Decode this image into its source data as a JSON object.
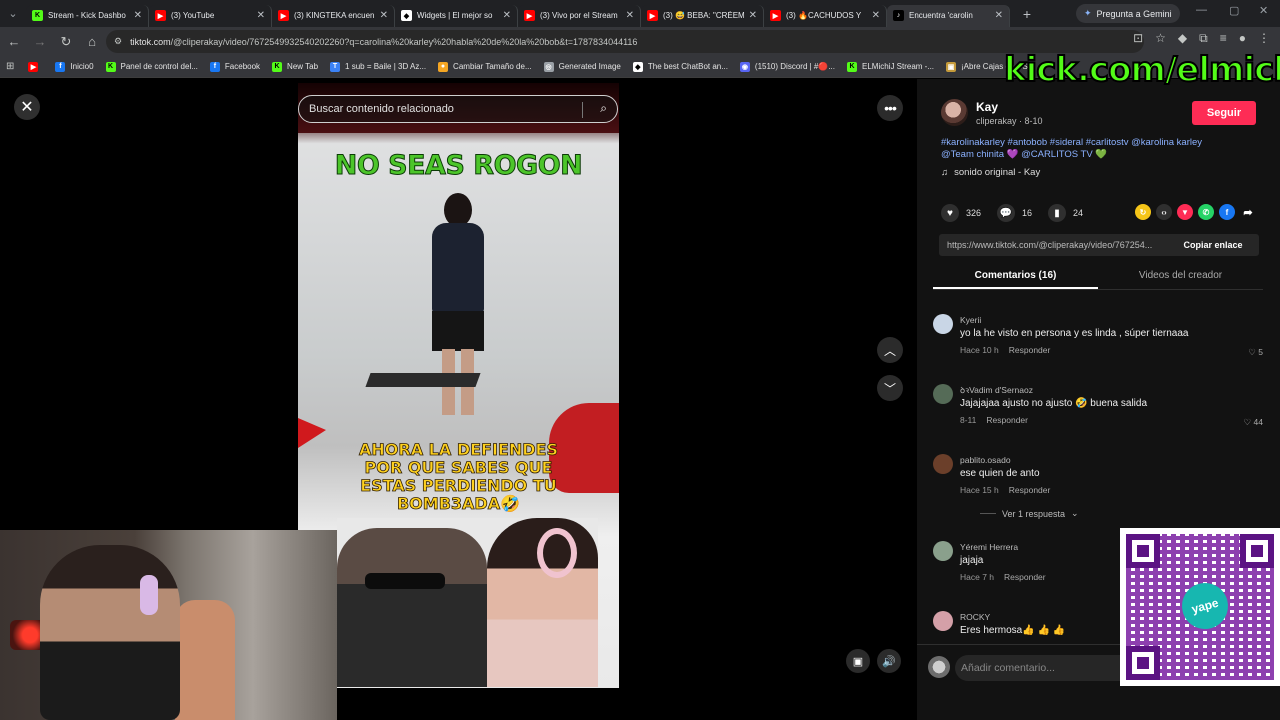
{
  "browser": {
    "tabs": [
      {
        "title": "Stream - Kick Dashbo",
        "fav": "K",
        "fav_color": "#53fc18"
      },
      {
        "title": "(3) YouTube",
        "fav": "▶",
        "fav_color": "#ff0000"
      },
      {
        "title": "(3) KINGTEKA encuen",
        "fav": "▶",
        "fav_color": "#ff0000"
      },
      {
        "title": "Widgets | El mejor so",
        "fav": "◆",
        "fav_color": "#ffffff"
      },
      {
        "title": "(3) Vivo por el Stream",
        "fav": "▶",
        "fav_color": "#ff0000"
      },
      {
        "title": "(3) 😅 BEBA: \"CRÉEM",
        "fav": "▶",
        "fav_color": "#ff0000"
      },
      {
        "title": "(3) 🔥CACHUDOS Y",
        "fav": "▶",
        "fav_color": "#ff0000"
      },
      {
        "title": "Encuentra 'carolin",
        "fav": "♪",
        "fav_color": "#000000"
      }
    ],
    "gemini_label": "Pregunta a Gemini",
    "url_host": "tiktok.com",
    "url_path": "/@cliperakay/video/7672549932540202260?q=carolina%20karley%20habla%20de%20la%20bob&t=1787834044116",
    "bookmarks": [
      {
        "label": "",
        "color": "#ff0000",
        "glyph": "▶"
      },
      {
        "label": "Inicio0",
        "color": "#1877f2",
        "glyph": "f"
      },
      {
        "label": "Panel de control del...",
        "color": "#53fc18",
        "glyph": "K"
      },
      {
        "label": "Facebook",
        "color": "#1877f2",
        "glyph": "f"
      },
      {
        "label": "New Tab",
        "color": "#53fc18",
        "glyph": "K"
      },
      {
        "label": "1 sub = Baile | 3D Az...",
        "color": "#3b82f6",
        "glyph": "T"
      },
      {
        "label": "Cambiar Tamaño de...",
        "color": "#f5a623",
        "glyph": "●"
      },
      {
        "label": "Generated Image",
        "color": "#9aa0a6",
        "glyph": "◎"
      },
      {
        "label": "The best ChatBot an...",
        "color": "#ffffff",
        "glyph": "◆"
      },
      {
        "label": "(1510) Discord | #🔴...",
        "color": "#5865f2",
        "glyph": "◉"
      },
      {
        "label": "ELMichiJ Stream -...",
        "color": "#53fc18",
        "glyph": "K"
      },
      {
        "label": "¡Abre Cajas de CS2",
        "color": "#c49a3a",
        "glyph": "▣"
      }
    ]
  },
  "video": {
    "search_placeholder": "Buscar contenido relacionado",
    "caption_top": "NO SEAS ROGON",
    "caption_bottom_lines": [
      "AHORA LA DEFIENDES",
      "POR QUE SABES QUE",
      "ESTAS PERDIENDO TU",
      "BOMB3ADA🤣"
    ]
  },
  "author": {
    "name": "Kay",
    "handle_date": "cliperakay · 8-10",
    "follow_label": "Seguir"
  },
  "description": {
    "line1": "#karolinakarley #antobob #sideral #carlitostv @karolina karley",
    "line2a": "@Team chinita",
    "line2b": "💜",
    "line2c": "@CARLITOS TV",
    "line2d": "💚",
    "music": "sonido original - Kay"
  },
  "stats": {
    "likes": "326",
    "comments": "16",
    "saves": "24"
  },
  "link": {
    "url": "https://www.tiktok.com/@cliperakay/video/767254...",
    "copy_label": "Copiar enlace"
  },
  "tabs": {
    "comments": "Comentarios (16)",
    "creator_videos": "Videos del creador"
  },
  "comments": [
    {
      "user": "Kyerii",
      "text": "yo la he visto en persona y es linda , súper tiernaaa",
      "time": "Hace 10 h",
      "reply": "Responder",
      "likes": "5",
      "avatar_color": "#c9d6e6"
    },
    {
      "user": "ꝺꝛVadim d'Sernaoz",
      "text": "Jajajajaa ajusto no ajusto 🤣 buena salida",
      "time": "8-11",
      "reply": "Responder",
      "likes": "44",
      "avatar_color": "#556b57"
    },
    {
      "user": "pablito.osado",
      "text": "ese quien de anto",
      "time": "Hace 15 h",
      "reply": "Responder",
      "likes": "",
      "avatar_color": "#6b3f2a"
    },
    {
      "user": "Yéremi Herrera",
      "text": "jajaja",
      "time": "Hace 7 h",
      "reply": "Responder",
      "likes": "",
      "avatar_color": "#8aa08c"
    },
    {
      "user": "ROCKY",
      "text": "Eres hermosa👍 👍 👍",
      "time": "",
      "reply": "",
      "likes": "",
      "avatar_color": "#d4a0a8"
    }
  ],
  "more_replies": "Ver 1 respuesta",
  "add_comment_placeholder": "Añadir comentario...",
  "overlay": {
    "kick_text": "kick.com/elmichij",
    "qr_logo": "yape"
  }
}
